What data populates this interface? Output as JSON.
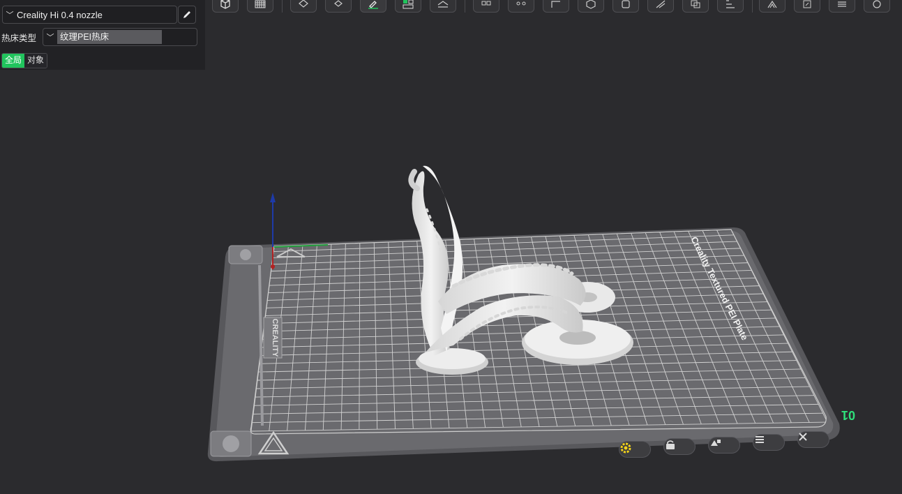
{
  "printer": {
    "name": "Creality Hi 0.4 nozzle"
  },
  "bed": {
    "label": "热床类型",
    "type": "纹理PEI热床"
  },
  "scope": {
    "global": "全局",
    "object": "对象"
  },
  "plate": {
    "print_text": "Creality Textured PEI Plate",
    "logo": "CREALITY",
    "number": "01"
  },
  "toolbar": [
    "view-cube-icon",
    "grid-icon",
    "auto-orient-icon",
    "arrange-icon",
    "paint-icon",
    "layout-icon",
    "cut-icon",
    "split-objects-icon",
    "support-icon",
    "measure-icon",
    "assembly-icon",
    "hollow-icon",
    "seam-icon",
    "boolean-icon",
    "text-icon",
    "height-range-icon",
    "brim-ears-icon",
    "emboss-icon",
    "layer-icon",
    "mesh-repair-icon"
  ],
  "colors": {
    "accent": "#21c45d",
    "background": "#2b2b2e",
    "panel": "#222225",
    "bed": "#6a6a6e",
    "grid": "#c8c8c8",
    "model": "#e4e4e4"
  }
}
